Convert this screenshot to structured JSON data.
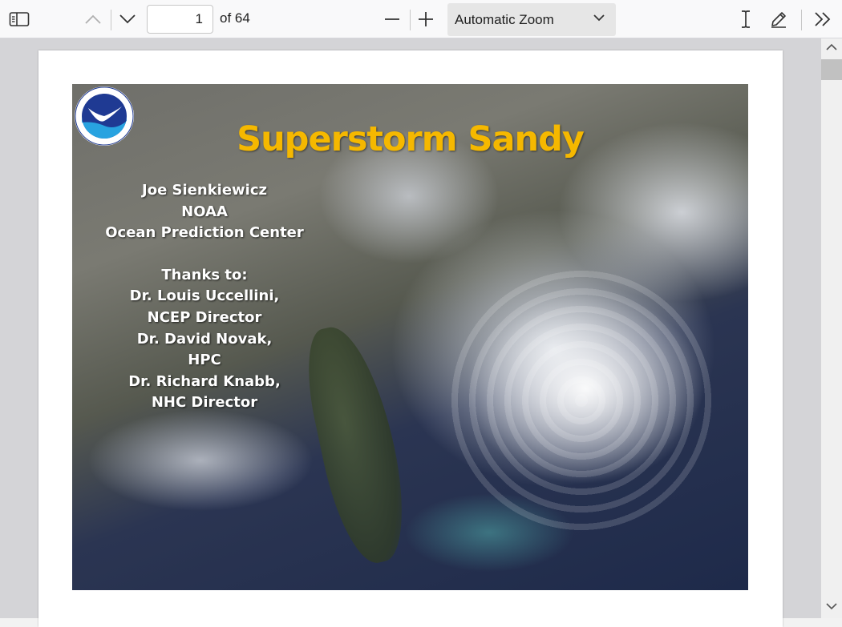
{
  "toolbar": {
    "current_page": "1",
    "page_count_label": "of 64",
    "zoom_label": "Automatic Zoom"
  },
  "slide": {
    "title": "Superstorm Sandy",
    "credit_lines": [
      "Joe Sienkiewicz",
      "NOAA",
      "Ocean Prediction Center",
      "",
      "Thanks to:",
      "Dr. Louis Uccellini,",
      "NCEP Director",
      "Dr. David Novak,",
      "HPC",
      "Dr. Richard Knabb,",
      "NHC Director"
    ],
    "logo_text": "NOAA",
    "title_color": "#f5b800"
  },
  "icons": {
    "sidebar": "sidebar-toggle-icon",
    "prev": "chevron-up-icon",
    "next": "chevron-down-icon",
    "zoom_out": "minus-icon",
    "zoom_in": "plus-icon",
    "text_select": "text-cursor-icon",
    "draw": "pen-icon",
    "more": "double-chevron-right-icon"
  }
}
